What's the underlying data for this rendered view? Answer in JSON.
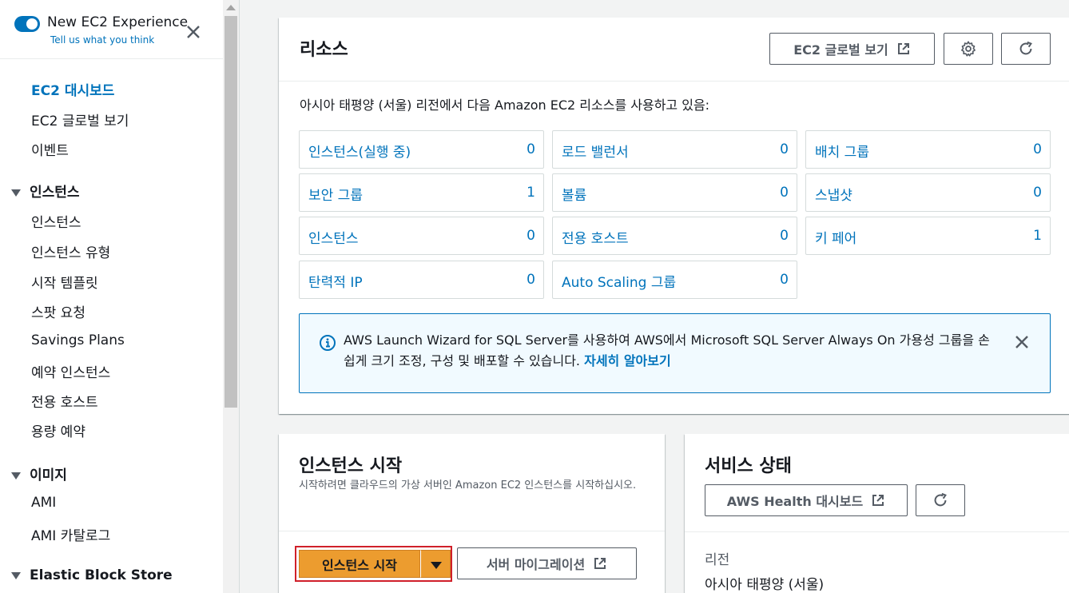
{
  "sidebar": {
    "toggle_label": "New EC2 Experience",
    "feedback_link": "Tell us what you think",
    "top_items": [
      {
        "label": "EC2 대시보드",
        "active": true
      },
      {
        "label": "EC2 글로벌 보기"
      },
      {
        "label": "이벤트"
      }
    ],
    "sections": [
      {
        "title": "인스턴스",
        "items": [
          "인스턴스",
          "인스턴스 유형",
          "시작 템플릿",
          "스팟 요청",
          "Savings Plans",
          "예약 인스턴스",
          "전용 호스트",
          "용량 예약"
        ]
      },
      {
        "title": "이미지",
        "items": [
          "AMI",
          "AMI 카탈로그"
        ]
      },
      {
        "title": "Elastic Block Store",
        "items": []
      }
    ]
  },
  "resources": {
    "title": "리소스",
    "global_view_button": "EC2 글로벌 보기",
    "description": "아시아 태평양 (서울) 리전에서 다음 Amazon EC2 리소스를 사용하고 있음:",
    "tiles": [
      {
        "label": "인스턴스(실행 중)",
        "value": "0"
      },
      {
        "label": "로드 밸런서",
        "value": "0"
      },
      {
        "label": "배치 그룹",
        "value": "0"
      },
      {
        "label": "보안 그룹",
        "value": "1"
      },
      {
        "label": "볼륨",
        "value": "0"
      },
      {
        "label": "스냅샷",
        "value": "0"
      },
      {
        "label": "인스턴스",
        "value": "0"
      },
      {
        "label": "전용 호스트",
        "value": "0"
      },
      {
        "label": "키 페어",
        "value": "1"
      },
      {
        "label": "탄력적 IP",
        "value": "0"
      },
      {
        "label": "Auto Scaling 그룹",
        "value": "0"
      }
    ],
    "info_banner": {
      "text": "AWS Launch Wizard for SQL Server를 사용하여 AWS에서 Microsoft SQL Server Always On 가용성 그룹을 손쉽게 크기 조정, 구성 및 배포할 수 있습니다. ",
      "link": "자세히 알아보기"
    }
  },
  "launch": {
    "title": "인스턴스 시작",
    "subtitle": "시작하려면 클라우드의 가상 서버인 Amazon EC2 인스턴스를 시작하십시오.",
    "launch_button": "인스턴스 시작",
    "migration_button": "서버 마이그레이션"
  },
  "service_health": {
    "title": "서비스 상태",
    "health_dashboard_button": "AWS Health 대시보드",
    "region_label": "리전",
    "region_value": "아시아 태평양 (서울)"
  },
  "colors": {
    "accent": "#0073bb",
    "primary_button": "#ec9c2f",
    "highlight_border": "#d0202a"
  }
}
